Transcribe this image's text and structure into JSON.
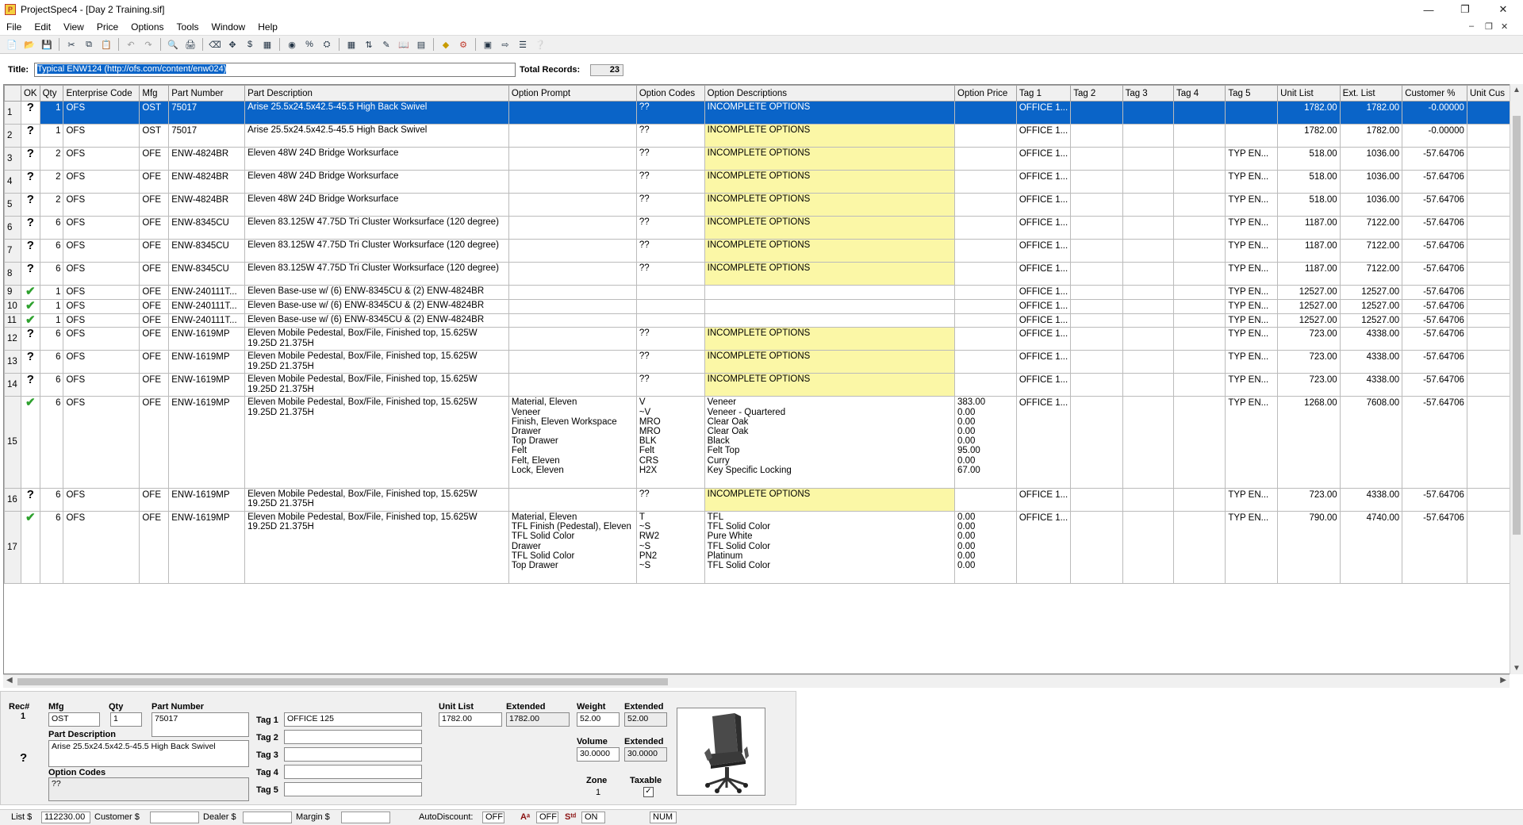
{
  "window": {
    "title": "ProjectSpec4 - [Day 2 Training.sif]"
  },
  "menu": [
    "File",
    "Edit",
    "View",
    "Price",
    "Options",
    "Tools",
    "Window",
    "Help"
  ],
  "titlebar_labels": {
    "title": "Title:",
    "title_value": "Typical ENW124  (http://ofs.com/content/enw024)",
    "total_label": "Total Records:",
    "total_value": "23"
  },
  "grid": {
    "columns": [
      "",
      "OK",
      "Qty",
      "Enterprise Code",
      "Mfg",
      "Part Number",
      "Part Description",
      "Option Prompt",
      "Option Codes",
      "Option Descriptions",
      "Option Price",
      "Tag 1",
      "Tag 2",
      "Tag 3",
      "Tag 4",
      "Tag 5",
      "Unit List",
      "Ext. List",
      "Customer %",
      "Unit Cus"
    ],
    "rows": [
      {
        "rn": "1",
        "ok": "?",
        "qty": "1",
        "ent": "OFS",
        "mfg": "OST",
        "pn": "75017",
        "desc": "Arise 25.5x24.5x42.5-45.5 High Back Swivel",
        "prompt": "",
        "codes": "??",
        "odesc": "INCOMPLETE OPTIONS",
        "oprice": "",
        "tag1": "OFFICE 1...",
        "tag5": "",
        "ul": "1782.00",
        "el": "1782.00",
        "cp": "-0.00000",
        "sel": true,
        "yel": false
      },
      {
        "rn": "2",
        "ok": "?",
        "qty": "1",
        "ent": "OFS",
        "mfg": "OST",
        "pn": "75017",
        "desc": "Arise 25.5x24.5x42.5-45.5 High Back Swivel",
        "prompt": "",
        "codes": "??",
        "odesc": "INCOMPLETE OPTIONS",
        "oprice": "",
        "tag1": "OFFICE 1...",
        "tag5": "",
        "ul": "1782.00",
        "el": "1782.00",
        "cp": "-0.00000",
        "sel": false,
        "yel": true
      },
      {
        "rn": "3",
        "ok": "?",
        "qty": "2",
        "ent": "OFS",
        "mfg": "OFE",
        "pn": "ENW-4824BR",
        "desc": "Eleven 48W 24D Bridge Worksurface",
        "prompt": "",
        "codes": "??",
        "odesc": "INCOMPLETE OPTIONS",
        "oprice": "",
        "tag1": "OFFICE 1...",
        "tag5": "TYP EN...",
        "ul": "518.00",
        "el": "1036.00",
        "cp": "-57.64706",
        "sel": false,
        "yel": true
      },
      {
        "rn": "4",
        "ok": "?",
        "qty": "2",
        "ent": "OFS",
        "mfg": "OFE",
        "pn": "ENW-4824BR",
        "desc": "Eleven 48W 24D Bridge Worksurface",
        "prompt": "",
        "codes": "??",
        "odesc": "INCOMPLETE OPTIONS",
        "oprice": "",
        "tag1": "OFFICE 1...",
        "tag5": "TYP EN...",
        "ul": "518.00",
        "el": "1036.00",
        "cp": "-57.64706",
        "sel": false,
        "yel": true
      },
      {
        "rn": "5",
        "ok": "?",
        "qty": "2",
        "ent": "OFS",
        "mfg": "OFE",
        "pn": "ENW-4824BR",
        "desc": "Eleven 48W 24D Bridge Worksurface",
        "prompt": "",
        "codes": "??",
        "odesc": "INCOMPLETE OPTIONS",
        "oprice": "",
        "tag1": "OFFICE 1...",
        "tag5": "TYP EN...",
        "ul": "518.00",
        "el": "1036.00",
        "cp": "-57.64706",
        "sel": false,
        "yel": true
      },
      {
        "rn": "6",
        "ok": "?",
        "qty": "6",
        "ent": "OFS",
        "mfg": "OFE",
        "pn": "ENW-8345CU",
        "desc": "Eleven 83.125W 47.75D Tri Cluster Worksurface (120 degree)",
        "prompt": "",
        "codes": "??",
        "odesc": "INCOMPLETE OPTIONS",
        "oprice": "",
        "tag1": "OFFICE 1...",
        "tag5": "TYP EN...",
        "ul": "1187.00",
        "el": "7122.00",
        "cp": "-57.64706",
        "sel": false,
        "yel": true
      },
      {
        "rn": "7",
        "ok": "?",
        "qty": "6",
        "ent": "OFS",
        "mfg": "OFE",
        "pn": "ENW-8345CU",
        "desc": "Eleven 83.125W 47.75D Tri Cluster Worksurface (120 degree)",
        "prompt": "",
        "codes": "??",
        "odesc": "INCOMPLETE OPTIONS",
        "oprice": "",
        "tag1": "OFFICE 1...",
        "tag5": "TYP EN...",
        "ul": "1187.00",
        "el": "7122.00",
        "cp": "-57.64706",
        "sel": false,
        "yel": true
      },
      {
        "rn": "8",
        "ok": "?",
        "qty": "6",
        "ent": "OFS",
        "mfg": "OFE",
        "pn": "ENW-8345CU",
        "desc": "Eleven 83.125W 47.75D Tri Cluster Worksurface (120 degree)",
        "prompt": "",
        "codes": "??",
        "odesc": "INCOMPLETE OPTIONS",
        "oprice": "",
        "tag1": "OFFICE 1...",
        "tag5": "TYP EN...",
        "ul": "1187.00",
        "el": "7122.00",
        "cp": "-57.64706",
        "sel": false,
        "yel": true
      },
      {
        "rn": "9",
        "ok": "✔",
        "qty": "1",
        "ent": "OFS",
        "mfg": "OFE",
        "pn": "ENW-240111T...",
        "desc": "Eleven Base-use w/ (6) ENW-8345CU & (2) ENW-4824BR",
        "prompt": "",
        "codes": "",
        "odesc": "",
        "oprice": "",
        "tag1": "OFFICE 1...",
        "tag5": "TYP EN...",
        "ul": "12527.00",
        "el": "12527.00",
        "cp": "-57.64706",
        "sel": false,
        "yel": false
      },
      {
        "rn": "10",
        "ok": "✔",
        "qty": "1",
        "ent": "OFS",
        "mfg": "OFE",
        "pn": "ENW-240111T...",
        "desc": "Eleven Base-use w/ (6) ENW-8345CU & (2) ENW-4824BR",
        "prompt": "",
        "codes": "",
        "odesc": "",
        "oprice": "",
        "tag1": "OFFICE 1...",
        "tag5": "TYP EN...",
        "ul": "12527.00",
        "el": "12527.00",
        "cp": "-57.64706",
        "sel": false,
        "yel": false
      },
      {
        "rn": "11",
        "ok": "✔",
        "qty": "1",
        "ent": "OFS",
        "mfg": "OFE",
        "pn": "ENW-240111T...",
        "desc": "Eleven Base-use w/ (6) ENW-8345CU & (2) ENW-4824BR",
        "prompt": "",
        "codes": "",
        "odesc": "",
        "oprice": "",
        "tag1": "OFFICE 1...",
        "tag5": "TYP EN...",
        "ul": "12527.00",
        "el": "12527.00",
        "cp": "-57.64706",
        "sel": false,
        "yel": false
      },
      {
        "rn": "12",
        "ok": "?",
        "qty": "6",
        "ent": "OFS",
        "mfg": "OFE",
        "pn": "ENW-1619MP",
        "desc": "Eleven Mobile Pedestal, Box/File, Finished top, 15.625W\n19.25D 21.375H",
        "prompt": "",
        "codes": "??",
        "odesc": "INCOMPLETE OPTIONS",
        "oprice": "",
        "tag1": "OFFICE 1...",
        "tag5": "TYP EN...",
        "ul": "723.00",
        "el": "4338.00",
        "cp": "-57.64706",
        "sel": false,
        "yel": true
      },
      {
        "rn": "13",
        "ok": "?",
        "qty": "6",
        "ent": "OFS",
        "mfg": "OFE",
        "pn": "ENW-1619MP",
        "desc": "Eleven Mobile Pedestal, Box/File, Finished top, 15.625W\n19.25D 21.375H",
        "prompt": "",
        "codes": "??",
        "odesc": "INCOMPLETE OPTIONS",
        "oprice": "",
        "tag1": "OFFICE 1...",
        "tag5": "TYP EN...",
        "ul": "723.00",
        "el": "4338.00",
        "cp": "-57.64706",
        "sel": false,
        "yel": true
      },
      {
        "rn": "14",
        "ok": "?",
        "qty": "6",
        "ent": "OFS",
        "mfg": "OFE",
        "pn": "ENW-1619MP",
        "desc": "Eleven Mobile Pedestal, Box/File, Finished top, 15.625W\n19.25D 21.375H",
        "prompt": "",
        "codes": "??",
        "odesc": "INCOMPLETE OPTIONS",
        "oprice": "",
        "tag1": "OFFICE 1...",
        "tag5": "TYP EN...",
        "ul": "723.00",
        "el": "4338.00",
        "cp": "-57.64706",
        "sel": false,
        "yel": true
      },
      {
        "rn": "15",
        "ok": "✔",
        "qty": "6",
        "ent": "OFS",
        "mfg": "OFE",
        "pn": "ENW-1619MP",
        "desc": "Eleven Mobile Pedestal, Box/File, Finished top, 15.625W\n19.25D 21.375H",
        "prompt": "Material, Eleven\nVeneer\nFinish, Eleven Workspace\nDrawer\nTop Drawer\nFelt\nFelt, Eleven\nLock, Eleven",
        "codes": "V\n~V\nMRO\nMRO\nBLK\nFelt\nCRS\nH2X",
        "odesc": "Veneer\nVeneer - Quartered\nClear Oak\nClear Oak\nBlack\nFelt Top\nCurry\nKey Specific Locking",
        "oprice": "383.00\n0.00\n0.00\n0.00\n0.00\n95.00\n0.00\n67.00",
        "tag1": "OFFICE 1...",
        "tag5": "TYP EN...",
        "ul": "1268.00",
        "el": "7608.00",
        "cp": "-57.64706",
        "sel": false,
        "yel": false
      },
      {
        "rn": "16",
        "ok": "?",
        "qty": "6",
        "ent": "OFS",
        "mfg": "OFE",
        "pn": "ENW-1619MP",
        "desc": "Eleven Mobile Pedestal, Box/File, Finished top, 15.625W\n19.25D 21.375H",
        "prompt": "",
        "codes": "??",
        "odesc": "INCOMPLETE OPTIONS",
        "oprice": "",
        "tag1": "OFFICE 1...",
        "tag5": "TYP EN...",
        "ul": "723.00",
        "el": "4338.00",
        "cp": "-57.64706",
        "sel": false,
        "yel": true
      },
      {
        "rn": "17",
        "ok": "✔",
        "qty": "6",
        "ent": "OFS",
        "mfg": "OFE",
        "pn": "ENW-1619MP",
        "desc": "Eleven Mobile Pedestal, Box/File, Finished top, 15.625W\n19.25D 21.375H",
        "prompt": "Material, Eleven\nTFL Finish (Pedestal), Eleven\nTFL Solid Color\nDrawer\nTFL Solid Color\nTop Drawer",
        "codes": "T\n~S\nRW2\n~S\nPN2\n~S",
        "odesc": "TFL\nTFL Solid Color\nPure White\nTFL Solid Color\nPlatinum\nTFL Solid Color",
        "oprice": "0.00\n0.00\n0.00\n0.00\n0.00\n0.00",
        "tag1": "OFFICE 1...",
        "tag5": "TYP EN...",
        "ul": "790.00",
        "el": "4740.00",
        "cp": "-57.64706",
        "sel": false,
        "yel": false
      }
    ]
  },
  "detail": {
    "rec_label": "Rec#",
    "rec_value": "1",
    "mfg_label": "Mfg",
    "mfg_value": "OST",
    "qty_label": "Qty",
    "qty_value": "1",
    "pn_label": "Part Number",
    "pn_value": "75017",
    "desc_label": "Part Description",
    "desc_value": "Arise 25.5x24.5x42.5-45.5 High Back Swivel",
    "codes_label": "Option Codes",
    "codes_value": "??",
    "status_icon": "?",
    "tags": [
      {
        "label": "Tag 1",
        "value": "OFFICE 125"
      },
      {
        "label": "Tag 2",
        "value": ""
      },
      {
        "label": "Tag 3",
        "value": ""
      },
      {
        "label": "Tag 4",
        "value": ""
      },
      {
        "label": "Tag 5",
        "value": ""
      }
    ],
    "unit_list_label": "Unit List",
    "unit_list_value": "1782.00",
    "extended_label": "Extended",
    "extended_value": "1782.00",
    "weight_label": "Weight",
    "weight_value": "52.00",
    "weight_ext_label": "Extended",
    "weight_ext_value": "52.00",
    "volume_label": "Volume",
    "volume_value": "30.0000",
    "volume_ext_label": "Extended",
    "volume_ext_value": "30.0000",
    "zone_label": "Zone",
    "zone_value": "1",
    "taxable_label": "Taxable"
  },
  "status": {
    "list_label": "List $",
    "list_value": "112230.00",
    "customer_label": "Customer $",
    "customer_value": "",
    "dealer_label": "Dealer $",
    "dealer_value": "",
    "margin_label": "Margin $",
    "margin_value": "",
    "autodiscount_label": "AutoDiscount:",
    "autodiscount_value": "OFF",
    "a_label": "Aᵃ",
    "a_value": "OFF",
    "std_label": "Sᵗᵈ",
    "std_value": "ON",
    "num_value": "NUM"
  },
  "colors": {
    "selection": "#0a64c8",
    "incomplete": "#fbf7a6",
    "check": "#2ea12e"
  }
}
